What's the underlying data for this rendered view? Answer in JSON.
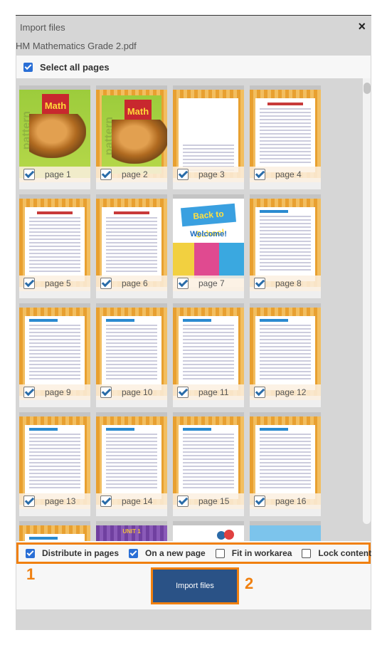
{
  "dialog": {
    "title": "Import files",
    "close_icon": "×",
    "filename": "HM Mathematics Grade 2.pdf"
  },
  "select_all": {
    "label": "Select all pages",
    "checked": true
  },
  "pages": [
    {
      "label": "page 1",
      "checked": true,
      "thumb": "cover"
    },
    {
      "label": "page 2",
      "checked": true,
      "thumb": "cover-stripes"
    },
    {
      "label": "page 3",
      "checked": true,
      "thumb": "copyright"
    },
    {
      "label": "page 4",
      "checked": true,
      "thumb": "authors"
    },
    {
      "label": "page 5",
      "checked": true,
      "thumb": "reviewers"
    },
    {
      "label": "page 6",
      "checked": true,
      "thumb": "reviewers"
    },
    {
      "label": "page 7",
      "checked": true,
      "thumb": "back-to-school"
    },
    {
      "label": "page 8",
      "checked": true,
      "thumb": "worksheet"
    },
    {
      "label": "page 9",
      "checked": true,
      "thumb": "worksheet"
    },
    {
      "label": "page 10",
      "checked": true,
      "thumb": "worksheet"
    },
    {
      "label": "page 11",
      "checked": true,
      "thumb": "worksheet"
    },
    {
      "label": "page 12",
      "checked": true,
      "thumb": "worksheet"
    },
    {
      "label": "page 13",
      "checked": true,
      "thumb": "worksheet"
    },
    {
      "label": "page 14",
      "checked": true,
      "thumb": "worksheet"
    },
    {
      "label": "page 15",
      "checked": true,
      "thumb": "worksheet"
    },
    {
      "label": "page 16",
      "checked": true,
      "thumb": "worksheet"
    },
    {
      "label": "",
      "checked": true,
      "thumb": "worksheet"
    },
    {
      "label": "",
      "checked": true,
      "thumb": "unit"
    },
    {
      "label": "",
      "checked": true,
      "thumb": "white-dots"
    },
    {
      "label": "",
      "checked": true,
      "thumb": "sky"
    }
  ],
  "thumb_text": {
    "math": "Math",
    "pattern": "pattern",
    "back_to_school": "Back to School",
    "welcome": "Welcome!",
    "unit": "UNIT 1"
  },
  "options": [
    {
      "label": "Distribute in pages",
      "checked": true
    },
    {
      "label": "On a new page",
      "checked": true
    },
    {
      "label": "Fit in workarea",
      "checked": false
    },
    {
      "label": "Lock content",
      "checked": false
    }
  ],
  "annotations": {
    "options_marker": "1",
    "button_marker": "2"
  },
  "import_button": {
    "label": "Import files"
  },
  "colors": {
    "accent": "#2a5286",
    "highlight": "#f08010",
    "checkbox": "#2a6fd6"
  }
}
